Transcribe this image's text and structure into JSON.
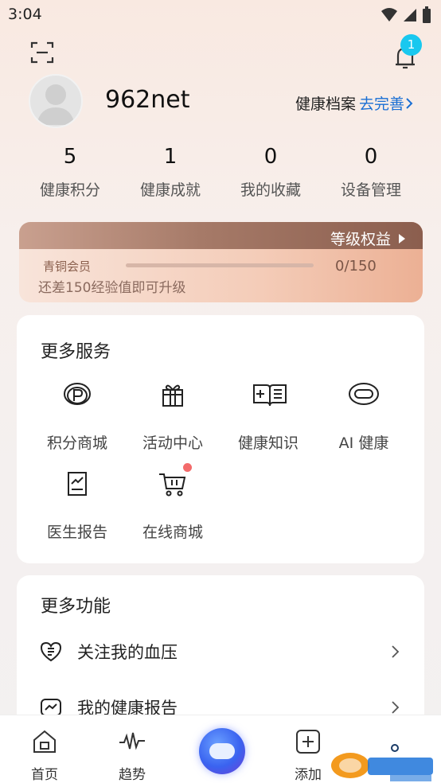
{
  "status_bar": {
    "time": "3:04"
  },
  "header": {
    "notification_count": "1"
  },
  "profile": {
    "username": "962net",
    "health_record_label": "健康档案",
    "health_record_link": "去完善"
  },
  "stats": [
    {
      "value": "5",
      "label": "健康积分"
    },
    {
      "value": "1",
      "label": "健康成就"
    },
    {
      "value": "0",
      "label": "我的收藏"
    },
    {
      "value": "0",
      "label": "设备管理"
    }
  ],
  "level": {
    "rights_label": "等级权益",
    "name": "青铜会员",
    "progress_text": "0/150",
    "progress_fraction": 0.0,
    "hint": "还差150经验值即可升级"
  },
  "services": {
    "title": "更多服务",
    "items": [
      {
        "label": "积分商城",
        "icon": "points-mall-icon"
      },
      {
        "label": "活动中心",
        "icon": "gift-icon"
      },
      {
        "label": "健康知识",
        "icon": "health-book-icon"
      },
      {
        "label": "AI 健康",
        "icon": "ai-chat-icon"
      },
      {
        "label": "医生报告",
        "icon": "doctor-report-icon"
      },
      {
        "label": "在线商城",
        "icon": "cart-icon"
      }
    ]
  },
  "functions": {
    "title": "更多功能",
    "items": [
      {
        "label": "关注我的血压",
        "icon": "heart-pressure-icon"
      },
      {
        "label": "我的健康报告",
        "icon": "health-report-icon"
      }
    ]
  },
  "tabbar": {
    "items": [
      {
        "label": "首页",
        "icon": "home-icon"
      },
      {
        "label": "趋势",
        "icon": "trend-icon"
      },
      {
        "label": "添加",
        "icon": "add-icon"
      }
    ]
  },
  "colors": {
    "accent": "#1a6fd4",
    "badge": "#19c8ef",
    "level": "#8b5e4e"
  }
}
